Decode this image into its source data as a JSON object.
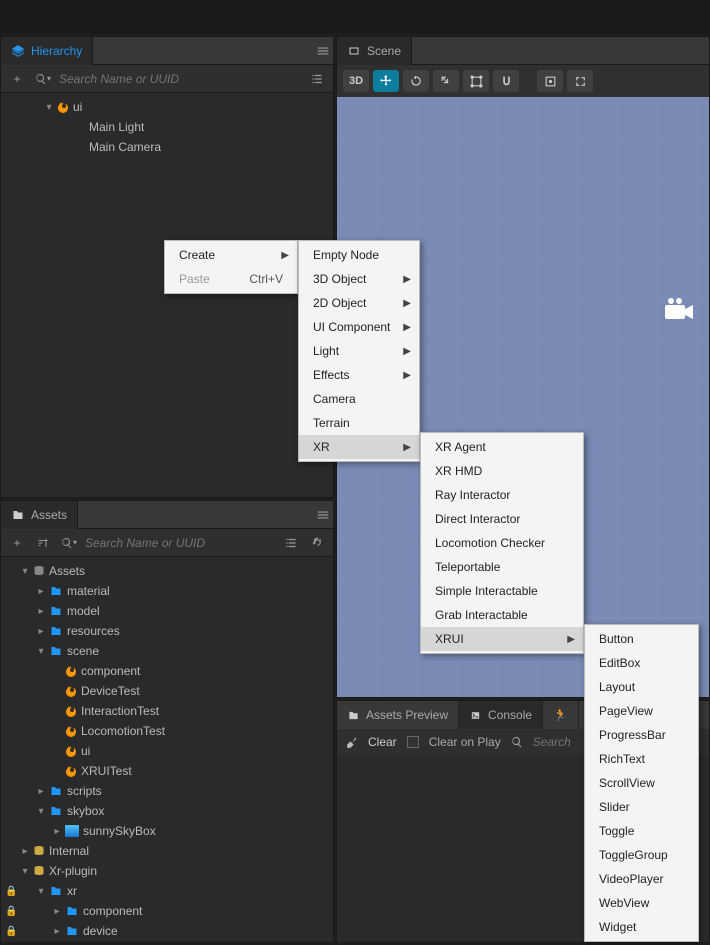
{
  "hierarchy": {
    "tab_title": "Hierarchy",
    "search_placeholder": "Search Name or UUID",
    "nodes": [
      {
        "label": "ui",
        "icon": "fire",
        "depth": 1,
        "caret": "down"
      },
      {
        "label": "Main Light",
        "icon": "none",
        "depth": 2,
        "caret": "none"
      },
      {
        "label": "Main Camera",
        "icon": "none",
        "depth": 2,
        "caret": "none"
      }
    ]
  },
  "assets": {
    "tab_title": "Assets",
    "search_placeholder": "Search Name or UUID",
    "nodes": [
      {
        "label": "Assets",
        "icon": "db",
        "depth": 0,
        "caret": "down"
      },
      {
        "label": "material",
        "icon": "folder",
        "depth": 1,
        "caret": "right"
      },
      {
        "label": "model",
        "icon": "folder",
        "depth": 1,
        "caret": "right"
      },
      {
        "label": "resources",
        "icon": "folder",
        "depth": 1,
        "caret": "right"
      },
      {
        "label": "scene",
        "icon": "folder",
        "depth": 1,
        "caret": "down"
      },
      {
        "label": "component",
        "icon": "fire",
        "depth": 2,
        "caret": "none"
      },
      {
        "label": "DeviceTest",
        "icon": "fire",
        "depth": 2,
        "caret": "none"
      },
      {
        "label": "InteractionTest",
        "icon": "fire",
        "depth": 2,
        "caret": "none"
      },
      {
        "label": "LocomotionTest",
        "icon": "fire",
        "depth": 2,
        "caret": "none"
      },
      {
        "label": "ui",
        "icon": "fire",
        "depth": 2,
        "caret": "none"
      },
      {
        "label": "XRUITest",
        "icon": "fire",
        "depth": 2,
        "caret": "none"
      },
      {
        "label": "scripts",
        "icon": "folder",
        "depth": 1,
        "caret": "right"
      },
      {
        "label": "skybox",
        "icon": "folder",
        "depth": 1,
        "caret": "down"
      },
      {
        "label": "sunnySkyBox",
        "icon": "sky",
        "depth": 2,
        "caret": "right"
      },
      {
        "label": "Internal",
        "icon": "db-yellow",
        "depth": 0,
        "caret": "right"
      },
      {
        "label": "Xr-plugin",
        "icon": "db-yellow",
        "depth": 0,
        "caret": "down"
      },
      {
        "label": "xr",
        "icon": "folder",
        "depth": 1,
        "caret": "down",
        "lock": true
      },
      {
        "label": "component",
        "icon": "folder",
        "depth": 2,
        "caret": "right",
        "lock": true
      },
      {
        "label": "device",
        "icon": "folder",
        "depth": 2,
        "caret": "right",
        "lock": true
      }
    ]
  },
  "scene": {
    "tab_title": "Scene",
    "tools": {
      "mode": "3D"
    }
  },
  "ctx1": {
    "items": [
      {
        "label": "Create",
        "arrow": true,
        "hover": false
      },
      {
        "label": "Paste",
        "shortcut": "Ctrl+V",
        "disabled": true
      }
    ]
  },
  "ctx2": {
    "items": [
      {
        "label": "Empty Node"
      },
      {
        "label": "3D Object",
        "arrow": true
      },
      {
        "label": "2D Object",
        "arrow": true
      },
      {
        "label": "UI Component",
        "arrow": true
      },
      {
        "label": "Light",
        "arrow": true
      },
      {
        "label": "Effects",
        "arrow": true
      },
      {
        "label": "Camera"
      },
      {
        "label": "Terrain"
      },
      {
        "label": "XR",
        "arrow": true,
        "hover": true
      }
    ]
  },
  "ctx3": {
    "items": [
      {
        "label": "XR Agent"
      },
      {
        "label": "XR HMD"
      },
      {
        "label": "Ray Interactor"
      },
      {
        "label": "Direct Interactor"
      },
      {
        "label": "Locomotion Checker"
      },
      {
        "label": "Teleportable"
      },
      {
        "label": "Simple Interactable"
      },
      {
        "label": "Grab Interactable"
      },
      {
        "label": "XRUI",
        "arrow": true,
        "hover": true
      }
    ]
  },
  "ctx4": {
    "items": [
      {
        "label": "Button"
      },
      {
        "label": "EditBox"
      },
      {
        "label": "Layout"
      },
      {
        "label": "PageView"
      },
      {
        "label": "ProgressBar"
      },
      {
        "label": "RichText"
      },
      {
        "label": "ScrollView"
      },
      {
        "label": "Slider"
      },
      {
        "label": "Toggle"
      },
      {
        "label": "ToggleGroup"
      },
      {
        "label": "VideoPlayer"
      },
      {
        "label": "WebView"
      },
      {
        "label": "Widget"
      }
    ]
  },
  "bottom": {
    "tabs": {
      "preview": "Assets Preview",
      "console": "Console"
    },
    "clear": "Clear",
    "clear_on_play": "Clear on Play",
    "search_placeholder": "Search"
  }
}
